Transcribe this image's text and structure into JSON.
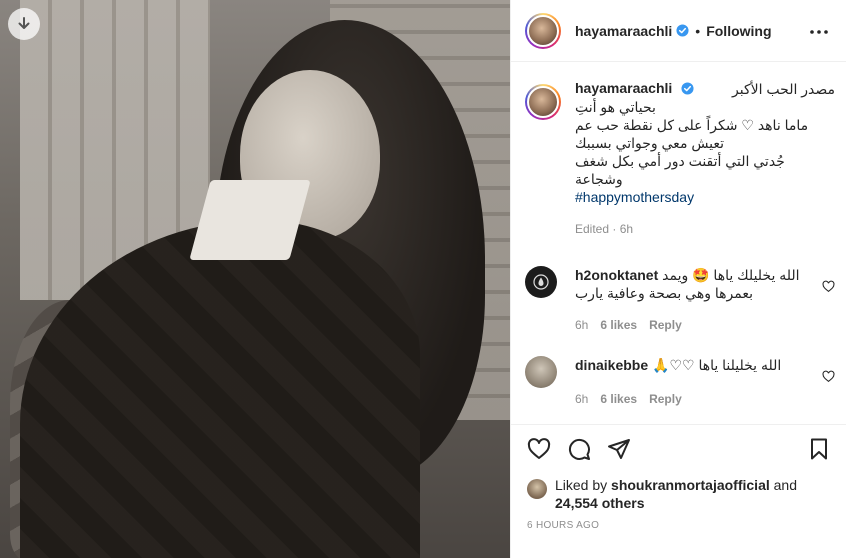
{
  "post": {
    "username": "hayamaraachli",
    "follow_state": "Following",
    "separator": "•"
  },
  "caption": {
    "username": "hayamaraachli",
    "lines": [
      "مصدر الحب الأكبر",
      "بحياتي هو أنتِ",
      "ماما ناهد ♡ شكراً على كل نقطة حب عم",
      "تعيش معي وجواتي بسببك",
      "جُدتي التي أتقنت دور أمي بكل شغف",
      "وشجاعة"
    ],
    "hashtag": "#happymothersday",
    "meta": "Edited · 6h"
  },
  "comments": [
    {
      "username": "h2onoktanet",
      "text": "الله يخليلك ياها 🤩 ويمد بعمرها وهي بصحة وعافية يارب",
      "time": "6h",
      "likes": "6 likes",
      "reply": "Reply"
    },
    {
      "username": "dinaikebbe",
      "text": "الله يخليلنا ياها ♡♡🙏",
      "time": "6h",
      "likes": "6 likes",
      "reply": "Reply"
    }
  ],
  "likes": {
    "prefix": "Liked by",
    "user": "shoukranmortajaofficial",
    "joiner": "and",
    "others": "24,554 others"
  },
  "timeago": "6 HOURS AGO",
  "colors": {
    "verified": "#3897f0",
    "hashtag": "#00376b",
    "muted": "#8e8e8e"
  },
  "icons": [
    "download-icon",
    "verified-icon",
    "more-icon",
    "heart-icon",
    "comment-icon",
    "share-icon",
    "bookmark-icon"
  ]
}
